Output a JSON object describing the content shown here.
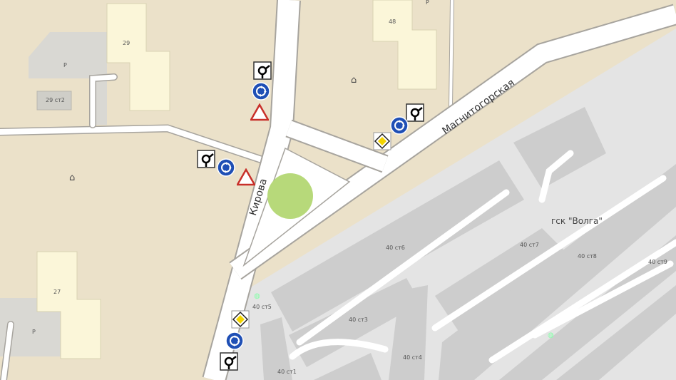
{
  "map": {
    "colors": {
      "land": "#ebe1c9",
      "road": "#ffffff",
      "road_edge": "#a7a49e",
      "garage_area": "#e3e3e3",
      "garage_building": "#cccccc",
      "building": "#fbf6d9",
      "parking": "#d9d8d3",
      "roundabout": "#b7d97a"
    },
    "streets": {
      "kirova": "Кирова",
      "magnitogorskaya": "Магнитогорская"
    },
    "buildings": {
      "b29": "29",
      "b48": "48",
      "b27": "27",
      "b29st2": "29 ст2"
    },
    "parking_labels": {
      "p1": "Р",
      "p2": "Р",
      "p3": "Р"
    },
    "garage": {
      "name": "гск \"Волга\"",
      "st1": "40 ст1",
      "st3": "40 ст3",
      "st4": "40 ст4",
      "st5": "40 ст5",
      "st6": "40 ст6",
      "st7": "40 ст7",
      "st8": "40 ст8",
      "st9": "40 ст9"
    },
    "signs": {
      "roundabout_ahead": "roundabout-ahead-sign",
      "roundabout_mandatory": "roundabout-mandatory-sign",
      "yield": "give-way-sign",
      "priority_road": "priority-road-sign"
    },
    "icons": {
      "poi": "house-poi-icon"
    }
  }
}
